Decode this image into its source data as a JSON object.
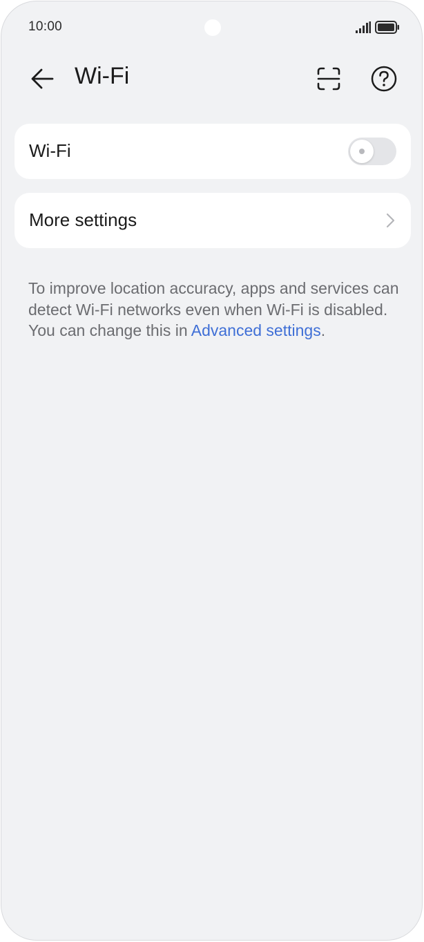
{
  "status_bar": {
    "time": "10:00",
    "signal_icon": "signal-icon",
    "battery_icon": "battery-icon"
  },
  "app_bar": {
    "back_icon": "arrow-left-icon",
    "title": "Wi-Fi",
    "scan_icon": "scan-icon",
    "help_icon": "help-circle-icon"
  },
  "wifi_card": {
    "label": "Wi-Fi",
    "toggle_state": "off"
  },
  "more_settings_card": {
    "label": "More settings",
    "chevron_icon": "chevron-right-icon"
  },
  "info": {
    "text": "To improve location accuracy, apps and services can detect Wi-Fi networks even when Wi-Fi is disabled. You can change this in ",
    "link_text": "Advanced settings",
    "trailing": "."
  },
  "colors": {
    "background": "#f1f2f4",
    "card": "#ffffff",
    "link": "#3f6fd6",
    "text_secondary": "#6b6c70"
  }
}
